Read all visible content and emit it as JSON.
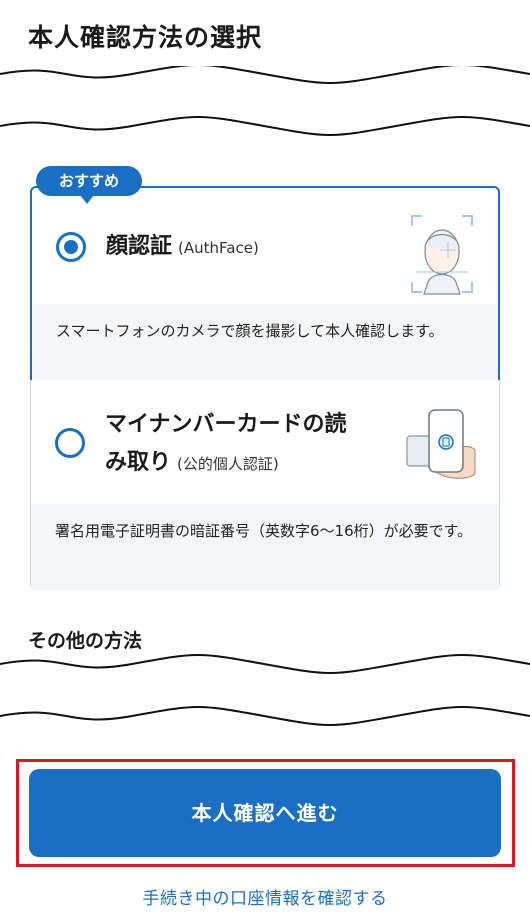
{
  "page": {
    "title": "本人確認方法の選択"
  },
  "badge": {
    "label": "おすすめ"
  },
  "options": [
    {
      "title": "顔認証",
      "subtitle": "(AuthFace)",
      "description": "スマートフォンのカメラで顔を撮影して本人確認します。",
      "selected": true,
      "illustration_icon": "face-scan-icon"
    },
    {
      "title_line1": "マイナンバーカードの読",
      "title_line2": "み取り",
      "subtitle": "(公的個人認証)",
      "description": "署名用電子証明書の暗証番号（英数字6〜16桁）が必要です。",
      "selected": false,
      "illustration_icon": "phone-card-reader-icon"
    }
  ],
  "other_methods": {
    "label": "その他の方法"
  },
  "cta": {
    "label": "本人確認へ進む"
  },
  "link": {
    "label": "手続き中の口座情報を確認する"
  },
  "colors": {
    "primary": "#1a6fc4",
    "highlight_frame": "#d11d27",
    "desc_bg": "#f5f6f7"
  }
}
